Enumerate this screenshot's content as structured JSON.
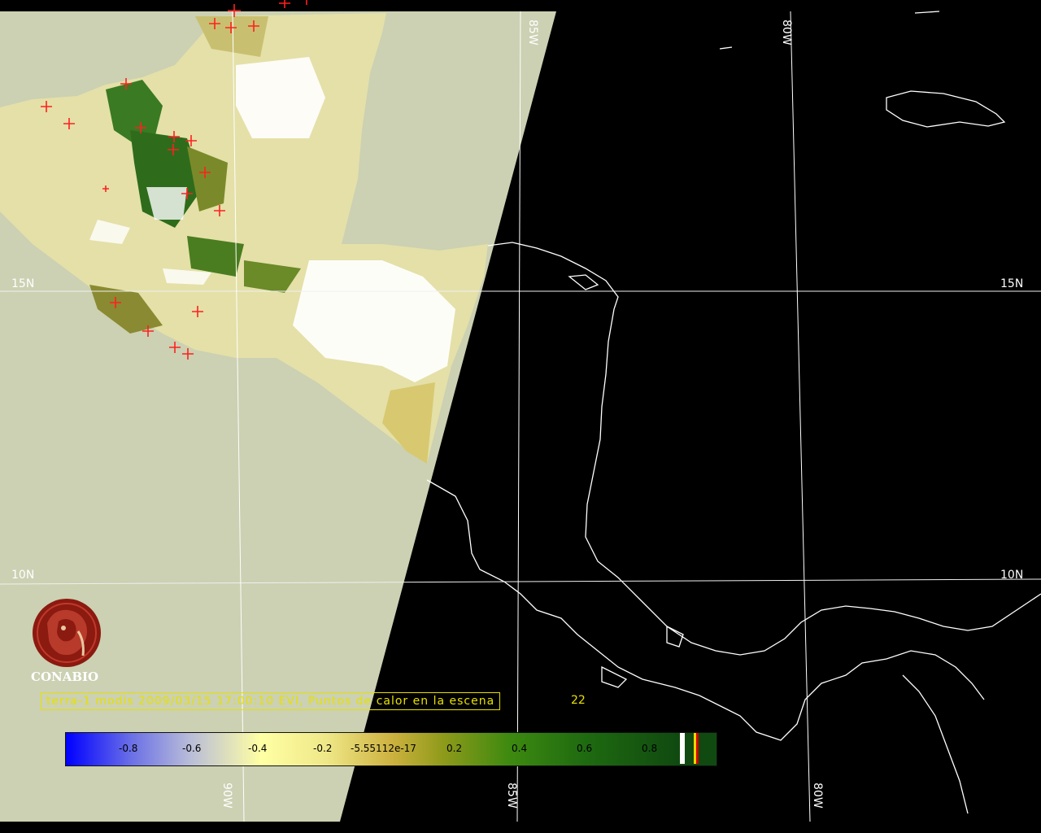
{
  "caption": {
    "text": "terra-1 modis 2009/03/15 17:00:10 EVI, Puntos de calor en la escena",
    "count": "22",
    "color": "#e8e000"
  },
  "logo": {
    "name": "CONABIO"
  },
  "gridlabels": {
    "lat": [
      "15N",
      "15N",
      "10N",
      "10N"
    ],
    "lon": [
      "85W",
      "80W",
      "90W",
      "85W",
      "80W"
    ]
  },
  "colorbar": {
    "labels": [
      "-0.8",
      "-0.6",
      "-0.4",
      "-0.2",
      "-5.55112e-17",
      "0.2",
      "0.4",
      "0.6",
      "0.8"
    ],
    "colors": [
      "#0000ff",
      "#b8bcd8",
      "#ffffa4",
      "#cdb240",
      "#3e8a10",
      "#104a10"
    ]
  },
  "colors": {
    "nodata": "#cbd1b2",
    "background": "#000000",
    "grid": "#ffffff",
    "coastline": "#ffffff",
    "hotspot": "#ff2020"
  }
}
